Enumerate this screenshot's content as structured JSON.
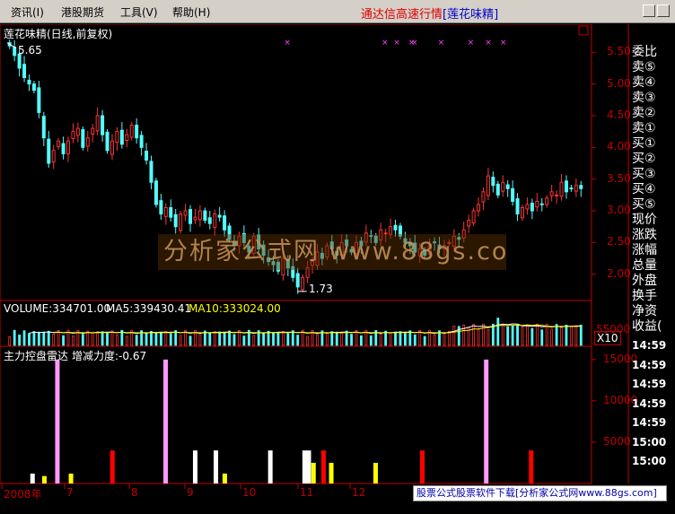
{
  "menu": {
    "items": [
      "资讯(I)",
      "港股期货",
      "工具(V)",
      "帮助(H)"
    ],
    "title": "通达信高速行情",
    "title_sub": "[莲花味精]"
  },
  "stock": {
    "name_label": "莲花味精(日线,前复权)",
    "high_label": "5.65",
    "low_label": "1.73"
  },
  "price_axis": [
    "5.50",
    "5.00",
    "4.50",
    "4.00",
    "3.50",
    "3.00",
    "2.50",
    "2.00"
  ],
  "volume": {
    "volume_label": "VOLUME:334701.00",
    "ma5_label": "MA5:339430.41",
    "ma10_label": "MA10:333024.00",
    "scale_label": "X10",
    "axis_label": "55000"
  },
  "indicator": {
    "name_label": "主力控盘雷达",
    "metric_label": "增减力度:-0.67",
    "axis": [
      "15000",
      "10000",
      "5000"
    ]
  },
  "time_axis": [
    "2008年",
    "7",
    "8",
    "9",
    "10",
    "11",
    "12"
  ],
  "right_panel": {
    "items": [
      "委比",
      "卖⑤",
      "卖④",
      "卖③",
      "卖②",
      "卖①",
      "买①",
      "买②",
      "买③",
      "买④",
      "买⑤",
      "现价",
      "涨跌",
      "涨幅",
      "总量",
      "外盘",
      "换手",
      "净资",
      "收益("
    ],
    "times": [
      "14:59",
      "14:59",
      "14:59",
      "14:59",
      "14:59",
      "15:00",
      "15:00"
    ]
  },
  "watermark": "分析家公式网 www.88gs.com",
  "ad_text": "股票公式股票软件下载[分析家公式网www.88gs.com]",
  "colors": {
    "up": "#ff3232",
    "down": "#54fcfc",
    "axis": "#c00000",
    "ma5": "#ffffff",
    "ma10": "#ffff00",
    "pink": "#ff99ff",
    "yellow": "#ffff00",
    "red": "#ff0000",
    "white": "#ffffff"
  },
  "chart_data": {
    "type": "candlestick",
    "price_range": [
      1.6,
      5.9
    ],
    "closes": [
      5.6,
      5.45,
      5.25,
      5.1,
      5.0,
      4.9,
      4.55,
      4.15,
      3.75,
      3.95,
      4.1,
      3.9,
      4.1,
      4.25,
      4.3,
      4.0,
      4.15,
      4.3,
      4.5,
      4.2,
      3.95,
      4.1,
      4.25,
      4.05,
      4.2,
      4.35,
      4.15,
      4.0,
      3.8,
      3.45,
      3.1,
      2.95,
      3.05,
      2.9,
      2.75,
      2.95,
      3.0,
      2.8,
      2.9,
      3.0,
      2.85,
      2.8,
      2.95,
      2.9,
      2.7,
      2.55,
      2.45,
      2.6,
      2.5,
      2.35,
      2.6,
      2.4,
      2.3,
      2.2,
      2.15,
      2.05,
      2.25,
      2.1,
      1.95,
      1.8,
      1.95,
      2.1,
      2.2,
      2.35,
      2.25,
      2.45,
      2.4,
      2.3,
      2.5,
      2.45,
      2.35,
      2.5,
      2.45,
      2.65,
      2.6,
      2.5,
      2.7,
      2.65,
      2.75,
      2.7,
      2.6,
      2.5,
      2.45,
      2.35,
      2.4,
      2.3,
      2.45,
      2.5,
      2.4,
      2.45,
      2.5,
      2.6,
      2.55,
      2.7,
      2.85,
      3.0,
      3.1,
      3.3,
      3.55,
      3.4,
      3.25,
      3.45,
      3.35,
      3.15,
      2.95,
      3.05,
      3.1,
      3.0,
      3.15,
      3.1,
      3.2,
      3.3,
      3.25,
      3.45,
      3.3,
      3.35,
      3.4,
      3.35
    ],
    "x_labels": [
      "2008年",
      "7",
      "8",
      "9",
      "10",
      "11",
      "12"
    ],
    "markers_count": 9,
    "indicator_bars": [
      {
        "pos": 0.055,
        "value": 1200,
        "color": "white"
      },
      {
        "pos": 0.075,
        "value": 900,
        "color": "yellow"
      },
      {
        "pos": 0.097,
        "value": 15000,
        "color": "pink"
      },
      {
        "pos": 0.12,
        "value": 1200,
        "color": "yellow"
      },
      {
        "pos": 0.19,
        "value": 4000,
        "color": "red"
      },
      {
        "pos": 0.28,
        "value": 15000,
        "color": "pink"
      },
      {
        "pos": 0.33,
        "value": 4000,
        "color": "white"
      },
      {
        "pos": 0.365,
        "value": 4000,
        "color": "white"
      },
      {
        "pos": 0.38,
        "value": 1200,
        "color": "yellow"
      },
      {
        "pos": 0.457,
        "value": 4000,
        "color": "white"
      },
      {
        "pos": 0.515,
        "value": 4000,
        "color": "white"
      },
      {
        "pos": 0.522,
        "value": 4000,
        "color": "white"
      },
      {
        "pos": 0.53,
        "value": 2500,
        "color": "yellow"
      },
      {
        "pos": 0.547,
        "value": 4000,
        "color": "red"
      },
      {
        "pos": 0.56,
        "value": 2500,
        "color": "yellow"
      },
      {
        "pos": 0.635,
        "value": 2500,
        "color": "yellow"
      },
      {
        "pos": 0.714,
        "value": 4000,
        "color": "red"
      },
      {
        "pos": 0.822,
        "value": 15000,
        "color": "pink"
      },
      {
        "pos": 0.898,
        "value": 4000,
        "color": "red"
      }
    ]
  }
}
